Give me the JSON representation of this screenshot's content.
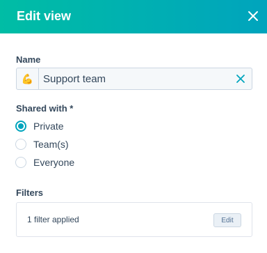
{
  "header": {
    "title": "Edit view",
    "close_icon": "close-icon"
  },
  "colors": {
    "accent": "#00a4bd",
    "header_gradient_start": "#00bda5",
    "header_gradient_end": "#00a4bd",
    "text": "#33475b"
  },
  "name_field": {
    "label": "Name",
    "emoji": "💪",
    "value": "Support team",
    "clear_icon": "close-icon"
  },
  "shared_with": {
    "label": "Shared with *",
    "options": [
      {
        "label": "Private",
        "checked": true
      },
      {
        "label": "Team(s)",
        "checked": false
      },
      {
        "label": "Everyone",
        "checked": false
      }
    ]
  },
  "filters": {
    "label": "Filters",
    "summary": "1 filter applied",
    "edit_label": "Edit"
  }
}
